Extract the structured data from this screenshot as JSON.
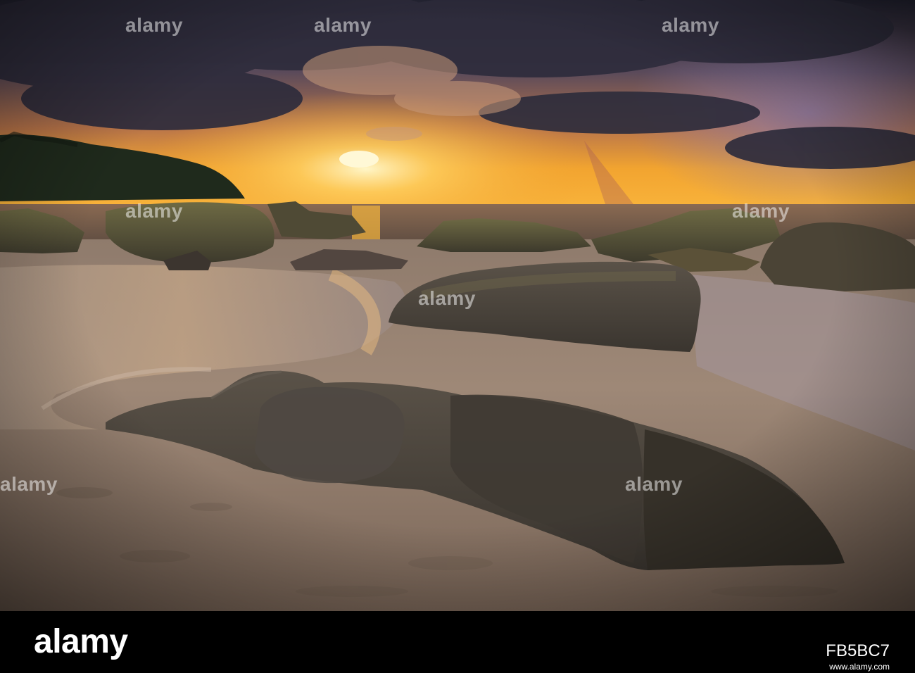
{
  "image": {
    "subject": "sunset over a rocky beach with wet sand, tidal channels, moss-covered boulders and a forested headland",
    "palette": {
      "sky_top": "#2b2a3a",
      "sky_glow": "#f4a52a",
      "sun": "#fff3b0",
      "sea": "#6d5a4a",
      "sand": "#9a8674",
      "rock": "#4a443c"
    }
  },
  "watermark": {
    "text": "alamy"
  },
  "footer": {
    "logo": "alamy",
    "image_id": "FB5BC7",
    "url": "www.alamy.com"
  }
}
